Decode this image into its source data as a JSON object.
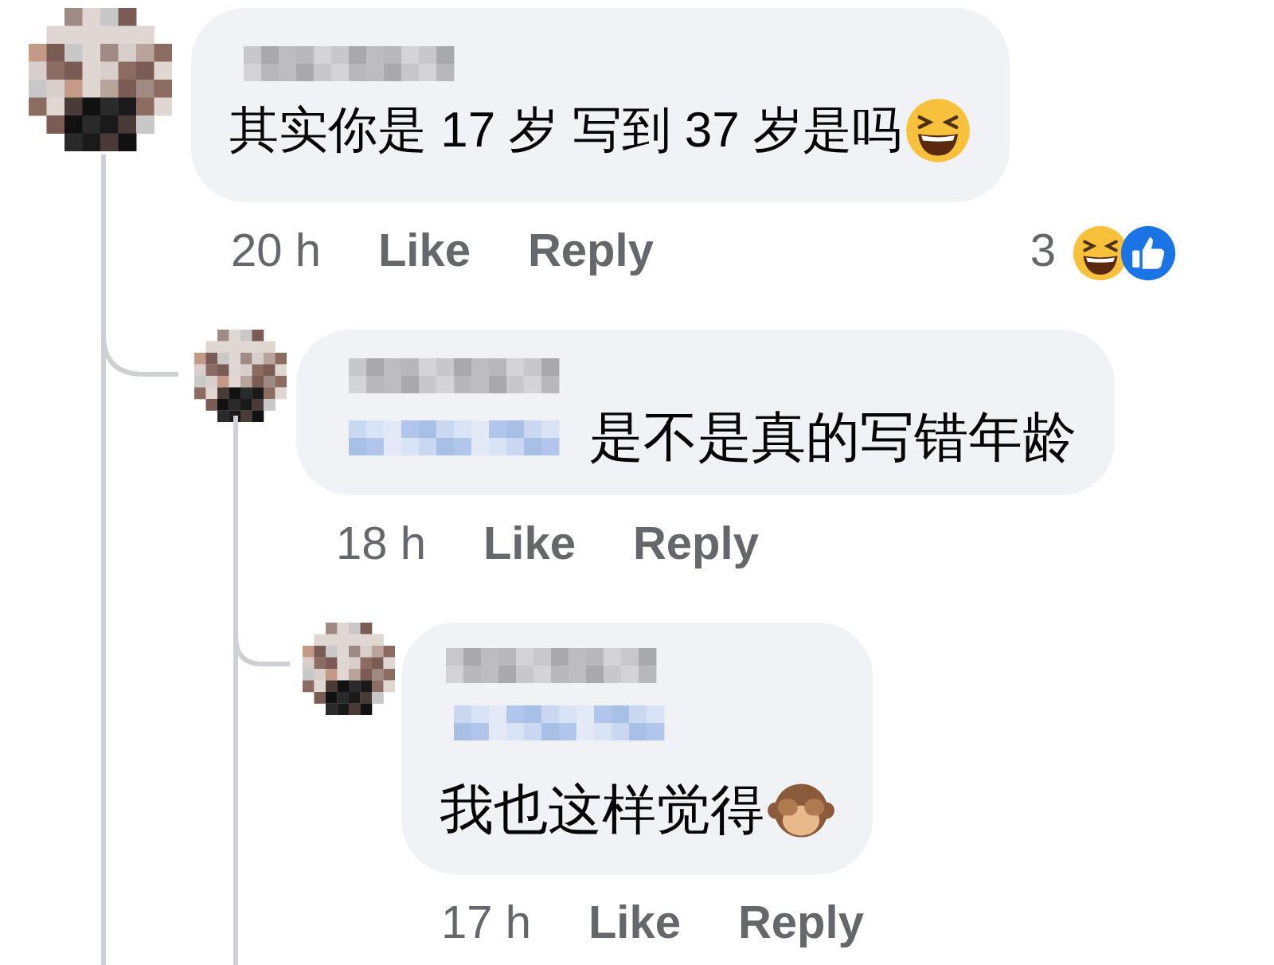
{
  "comments": [
    {
      "text": "其实你是 17 岁 写到 37 岁是吗",
      "kind": "laughing",
      "time": "20 h",
      "actions": [
        "Like",
        "Reply"
      ],
      "reaction_count": "3",
      "mention": false,
      "children": [
        {
          "text": "是不是真的写错年龄",
          "time": "18 h",
          "actions": [
            "Like",
            "Reply"
          ],
          "mention": true,
          "children": [
            {
              "text": "我也这样觉得",
              "kind": "monkey",
              "time": "17 h",
              "actions": [
                "Like",
                "Reply"
              ],
              "mention": true
            }
          ]
        }
      ]
    }
  ]
}
